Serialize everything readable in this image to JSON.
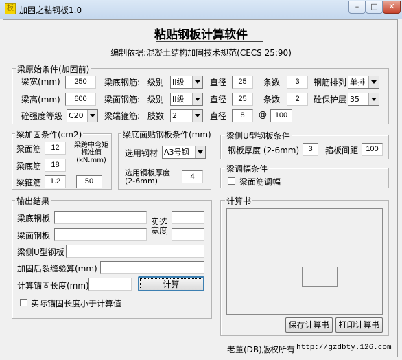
{
  "window": {
    "title": "加固之粘钢板1.0",
    "icon": "app-icon",
    "minimize": "–",
    "maximize": "□",
    "close": "✕"
  },
  "header": {
    "title": "粘贴钢板计算软件",
    "basis": "编制依据:混凝土结构加固技术规范(CECS 25:90)"
  },
  "original": {
    "group_label": "梁原始条件(加固前)",
    "beam_width_label": "梁宽(mm)",
    "beam_width": "250",
    "beam_height_label": "梁高(mm)",
    "beam_height": "600",
    "concrete_grade_label": "砼强度等级",
    "concrete_grade": "C20",
    "bottom_bar_label": "梁底钢筋:",
    "top_bar_label": "梁面钢筋:",
    "stirrup_label": "梁端箍筋:",
    "grade_label": "级别",
    "bottom_grade": "II级",
    "top_grade": "II级",
    "diameter_label": "直径",
    "bottom_diameter": "25",
    "top_diameter": "25",
    "count_label": "条数",
    "bottom_count": "3",
    "top_count": "2",
    "legs_label": "肢数",
    "stirrup_legs": "2",
    "stirrup_diameter": "8",
    "at_label": "@",
    "stirrup_spacing": "100",
    "arrangement_label": "钢筋排列",
    "arrangement": "单排",
    "cover_label": "砼保护层",
    "cover": "35"
  },
  "strengthen": {
    "group_label": "梁加固条件(cm2)",
    "top_bar_label": "梁面筋",
    "top_bar": "12",
    "bottom_bar_label": "梁底筋",
    "bottom_bar": "18",
    "stirrup_label": "梁箍筋",
    "stirrup": "1.2",
    "moment_label": "梁跨中弯矩标准值(kN.mm)",
    "moment": "50"
  },
  "bottom_plate": {
    "group_label": "梁底面贴钢板条件(mm)",
    "steel_label": "选用钢材",
    "steel": "A3号钢",
    "thickness_label": "选用钢板厚度(2-6mm)",
    "thickness": "4"
  },
  "u_plate": {
    "group_label": "梁侧U型钢板条件",
    "thickness_label": "钢板厚度 (2-6mm)",
    "thickness": "3",
    "spacing_label": "箍板间距",
    "spacing": "100"
  },
  "amplitude": {
    "group_label": "梁调幅条件",
    "checkbox_label": "梁面筋调幅"
  },
  "output": {
    "group_label": "输出结果",
    "bottom_plate_label": "梁底钢板",
    "top_plate_label": "梁面钢板",
    "u_plate_label": "梁侧U型钢板",
    "crack_label": "加固后裂缝验算(mm)",
    "anchor_label": "计算锚固长度(mm)",
    "actual_width_label": "实选宽度",
    "calculate_button": "计算",
    "anchor_checkbox_label": "实际锚固长度小于计算值"
  },
  "calc_book": {
    "group_label": "计算书",
    "save_button": "保存计算书",
    "print_button": "打印计算书"
  },
  "footer": {
    "copyright": "老董(DB)版权所有",
    "url": "http://gzdbty.126.com"
  }
}
